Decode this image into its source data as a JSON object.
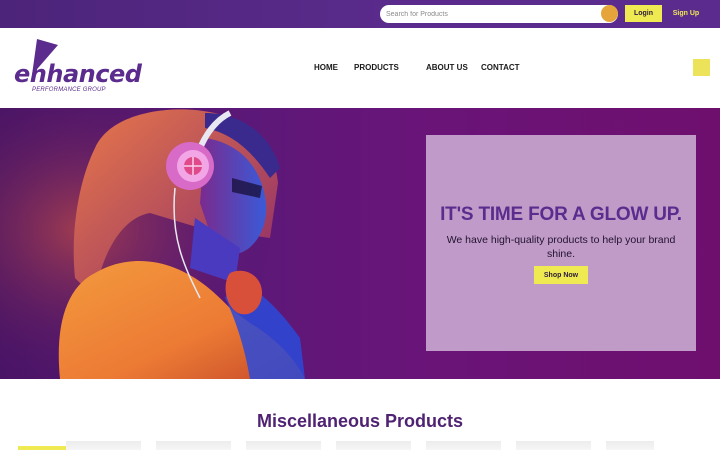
{
  "topbar": {
    "search_placeholder": "Search for Products",
    "login_label": "Login",
    "signup_label": "Sign Up"
  },
  "header": {
    "logo_word": "enhanced",
    "logo_tagline": "PERFORMANCE GROUP",
    "nav": [
      "HOME",
      "PRODUCTS",
      "ABOUT US",
      "CONTACT"
    ]
  },
  "hero": {
    "heading": "IT'S TIME FOR A GLOW UP.",
    "text": "We have high-quality products to help your brand shine.",
    "button_label": "Shop Now"
  },
  "section": {
    "title": "Miscellaneous Products"
  },
  "colors": {
    "brand_purple": "#5b2c8e",
    "accent_yellow": "#f0ea52",
    "search_button": "#e6a53a"
  }
}
